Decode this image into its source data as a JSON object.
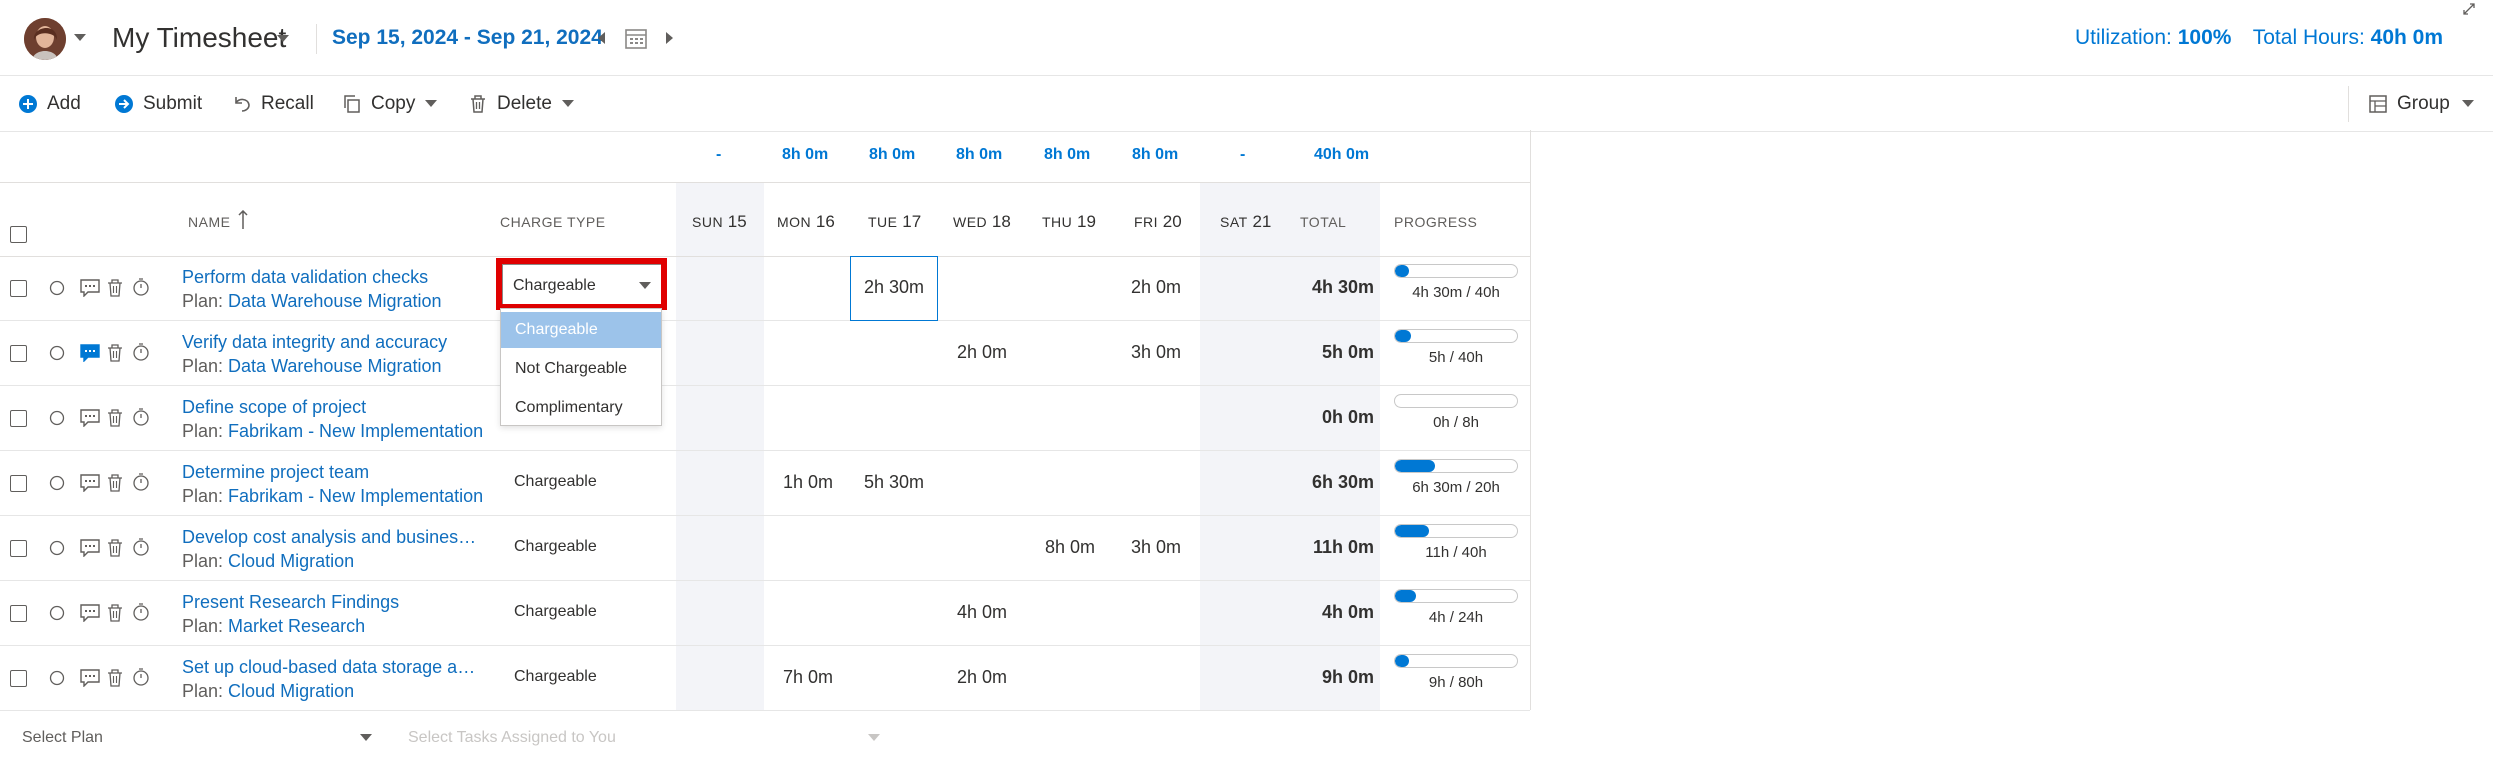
{
  "header": {
    "title": "My Timesheet",
    "date_range": "Sep 15, 2024 - Sep 21, 2024",
    "utilization_label": "Utilization:",
    "utilization_value": "100%",
    "total_hours_label": "Total Hours:",
    "total_hours_value": "40h 0m"
  },
  "toolbar": {
    "add": "Add",
    "submit": "Submit",
    "recall": "Recall",
    "copy": "Copy",
    "delete": "Delete",
    "group": "Group"
  },
  "columns": {
    "name": "NAME",
    "charge_type": "CHARGE TYPE",
    "days": [
      {
        "dow": "SUN",
        "num": "15",
        "sum": "-"
      },
      {
        "dow": "MON",
        "num": "16",
        "sum": "8h 0m"
      },
      {
        "dow": "TUE",
        "num": "17",
        "sum": "8h 0m"
      },
      {
        "dow": "WED",
        "num": "18",
        "sum": "8h 0m"
      },
      {
        "dow": "THU",
        "num": "19",
        "sum": "8h 0m"
      },
      {
        "dow": "FRI",
        "num": "20",
        "sum": "8h 0m"
      },
      {
        "dow": "SAT",
        "num": "21",
        "sum": "-"
      }
    ],
    "total": "TOTAL",
    "total_sum": "40h 0m",
    "progress": "PROGRESS"
  },
  "rows": [
    {
      "name": "Perform data validation checks",
      "plan_label": "Plan:",
      "plan": "Data Warehouse Migration",
      "charge": "Chargeable",
      "cells": [
        "",
        "",
        "2h 30m",
        "",
        "",
        "2h 0m",
        ""
      ],
      "total": "4h 30m",
      "progress": 0.1125,
      "progress_label": "4h 30m / 40h"
    },
    {
      "name": "Verify data integrity and accuracy",
      "plan_label": "Plan:",
      "plan": "Data Warehouse Migration",
      "charge": "",
      "cells": [
        "",
        "",
        "",
        "2h 0m",
        "",
        "3h 0m",
        ""
      ],
      "total": "5h 0m",
      "progress": 0.125,
      "progress_label": "5h / 40h"
    },
    {
      "name": "Define scope of project",
      "plan_label": "Plan:",
      "plan": "Fabrikam - New Implementation",
      "charge": "",
      "cells": [
        "",
        "",
        "",
        "",
        "",
        "",
        ""
      ],
      "total": "0h 0m",
      "progress": 0,
      "progress_label": "0h / 8h"
    },
    {
      "name": "Determine project team",
      "plan_label": "Plan:",
      "plan": "Fabrikam - New Implementation",
      "charge": "Chargeable",
      "cells": [
        "",
        "1h 0m",
        "5h 30m",
        "",
        "",
        "",
        ""
      ],
      "total": "6h 30m",
      "progress": 0.325,
      "progress_label": "6h 30m / 20h"
    },
    {
      "name": "Develop cost analysis and business ...",
      "plan_label": "Plan:",
      "plan": "Cloud Migration",
      "charge": "Chargeable",
      "cells": [
        "",
        "",
        "",
        "",
        "8h 0m",
        "3h 0m",
        ""
      ],
      "total": "11h 0m",
      "progress": 0.275,
      "progress_label": "11h / 40h"
    },
    {
      "name": "Present Research Findings",
      "plan_label": "Plan:",
      "plan": "Market Research",
      "charge": "Chargeable",
      "cells": [
        "",
        "",
        "",
        "4h 0m",
        "",
        "",
        ""
      ],
      "total": "4h 0m",
      "progress": 0.1667,
      "progress_label": "4h / 24h"
    },
    {
      "name": "Set up cloud-based data storage an...",
      "plan_label": "Plan:",
      "plan": "Cloud Migration",
      "charge": "Chargeable",
      "cells": [
        "",
        "7h 0m",
        "",
        "2h 0m",
        "",
        "",
        ""
      ],
      "total": "9h 0m",
      "progress": 0.1125,
      "progress_label": "9h / 80h"
    }
  ],
  "dropdown": {
    "current": "Chargeable",
    "options": [
      "Chargeable",
      "Not Chargeable",
      "Complimentary"
    ],
    "selected_index": 0
  },
  "footer": {
    "select_plan": "Select Plan",
    "select_tasks": "Select Tasks Assigned to You"
  },
  "colors": {
    "accent": "#0078d4",
    "link": "#106ebe",
    "highlight_border": "#e00000",
    "weekend_shade": "#f3f4f8"
  }
}
